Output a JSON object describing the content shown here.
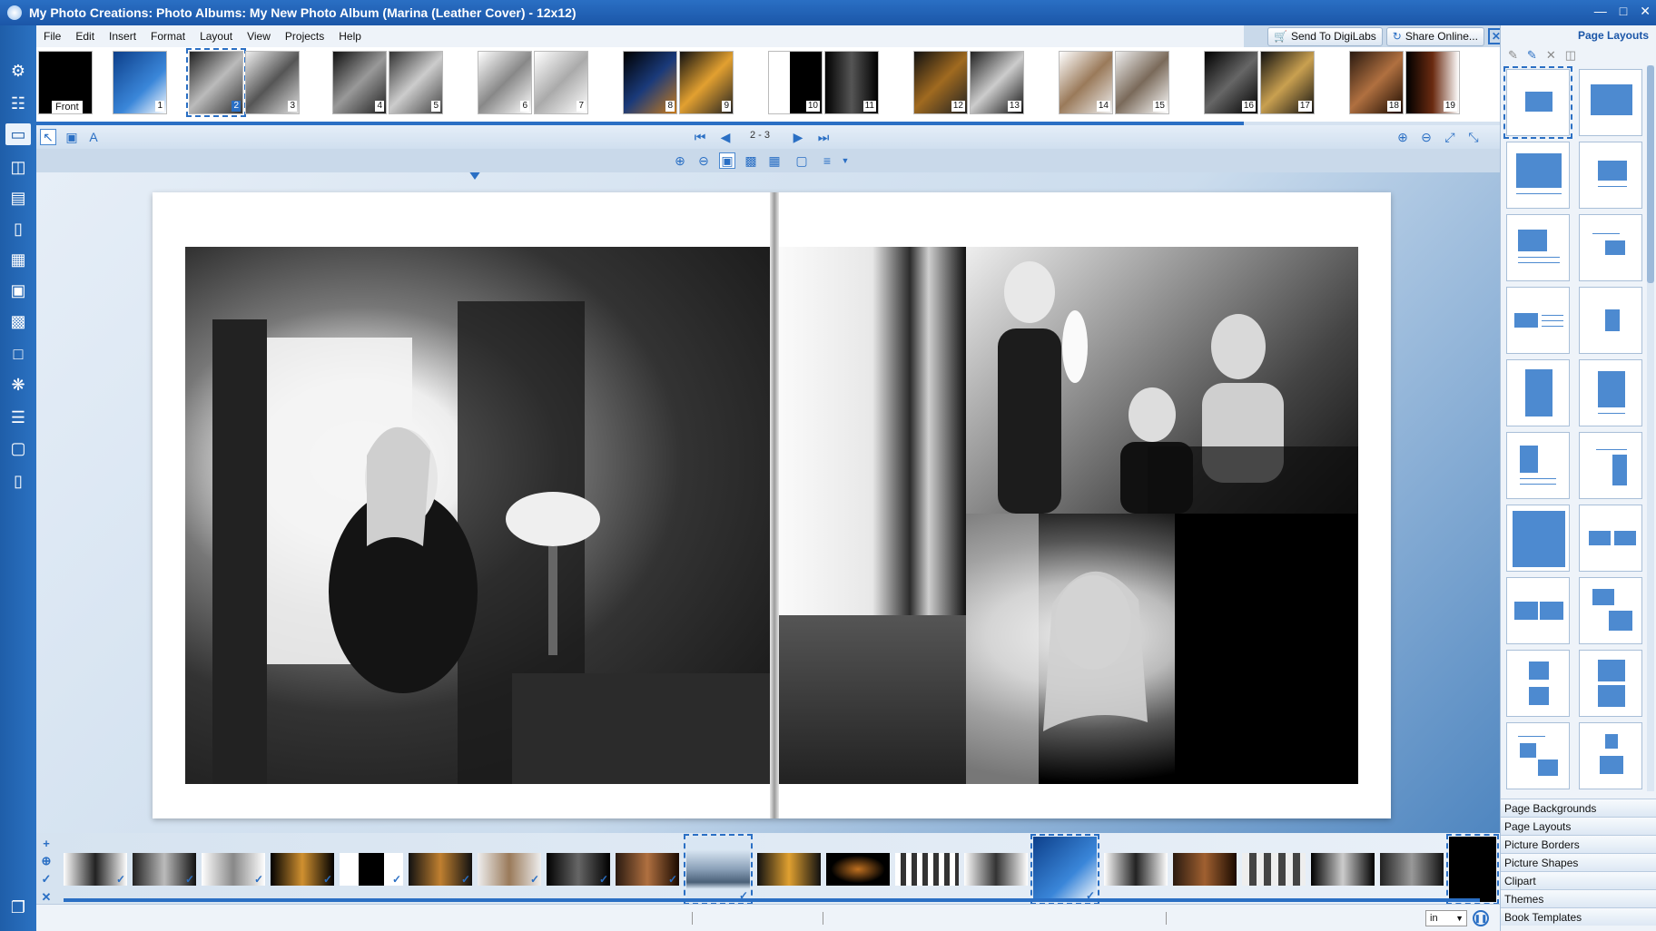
{
  "window": {
    "title": "My Photo Creations: Photo Albums: My New Photo Album (Marina (Leather Cover) - 12x12)"
  },
  "menu": [
    "File",
    "Edit",
    "Insert",
    "Format",
    "Layout",
    "View",
    "Projects",
    "Help"
  ],
  "top_buttons": {
    "send_to": "Send To DigiLabs",
    "share": "Share Online..."
  },
  "page_strip": {
    "front_label": "Front",
    "selected_page": "2",
    "pages": [
      "1",
      "2",
      "3",
      "4",
      "5",
      "6",
      "7",
      "8",
      "9",
      "10",
      "11",
      "12",
      "13",
      "14",
      "15",
      "16",
      "17",
      "18",
      "19"
    ]
  },
  "navigation": {
    "page_indicator": "2 - 3"
  },
  "right_panel": {
    "title": "Page Layouts",
    "sections": [
      "Page Backgrounds",
      "Page Layouts",
      "Picture Borders",
      "Picture Shapes",
      "Clipart",
      "Themes",
      "Book Templates"
    ]
  },
  "status_bar": {
    "unit": "in"
  },
  "colors": {
    "accent": "#2a6fc4",
    "titlebar": "#1b56a8",
    "layout_block": "#4d8ad0"
  },
  "icons": {
    "left_toolbar": [
      "settings-icon",
      "book-icon",
      "page-icon",
      "album-open-icon",
      "film-strip-icon",
      "phone-icon",
      "layout-icon",
      "frame-icon",
      "border-icon",
      "bookmark-icon",
      "clipart-icon",
      "card-icon",
      "tag-icon",
      "booklet-icon",
      "copy-icon"
    ]
  }
}
